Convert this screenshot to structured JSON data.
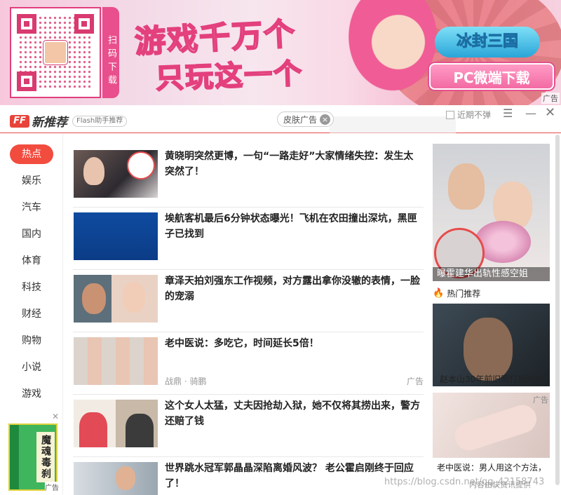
{
  "banner": {
    "scan_text": "扫码下载",
    "headline_line1": "游戏千万个",
    "headline_line2": "只玩这一个",
    "game_logo": "冰封三国",
    "download_button": "PC微端下载",
    "ad_label": "广告"
  },
  "header": {
    "brand_logo": "FF",
    "brand_name": "新推荐",
    "brand_sub": "Flash助手推荐",
    "skin_ad_label": "皮肤广告",
    "no_popup_label": "近期不弹",
    "accent_color": "#e8433a"
  },
  "sidebar": {
    "items": [
      "热点",
      "娱乐",
      "汽车",
      "国内",
      "体育",
      "科技",
      "财经",
      "购物",
      "小说",
      "游戏"
    ],
    "active_index": 0,
    "ad": {
      "book_title": "魔魂毒刹",
      "ad_label": "广告"
    }
  },
  "feed": [
    {
      "title": "黄晓明突然更博，一句“一路走好”大家情绪失控：发生太突然了！",
      "source": "",
      "ad": ""
    },
    {
      "title": "埃航客机最后6分钟状态曝光！飞机在农田撞出深坑，黑匣子已找到",
      "source": "",
      "ad": ""
    },
    {
      "title": "章泽天拍刘强东工作视频，对方露出拿你没辙的表情，一脸的宠溺",
      "source": "",
      "ad": ""
    },
    {
      "title": "老中医说：多吃它，时间延长5倍！",
      "source": "战鼎 · 骑鹏",
      "ad": "广告"
    },
    {
      "title": "这个女人太猛，丈夫因抢劫入狱，她不仅将其捞出来，警方还赔了钱",
      "source": "",
      "ad": ""
    },
    {
      "title": "世界跳水冠军郭晶晶深陷离婚风波？ 老公霍启刚终于回应了！",
      "source": "",
      "ad": ""
    }
  ],
  "right": {
    "top_caption": "曝霍建华出轨性感空姐",
    "hot_label": "热门推荐",
    "mid_caption": "赵本山30年前旧照打扮时尚",
    "bottom_ad": "广告",
    "bottom_caption": "老中医说：男人用这个方法，",
    "bottom_source": "内容由快资讯提供"
  },
  "watermark": "https://blog.csdn.net/qq_42158743"
}
